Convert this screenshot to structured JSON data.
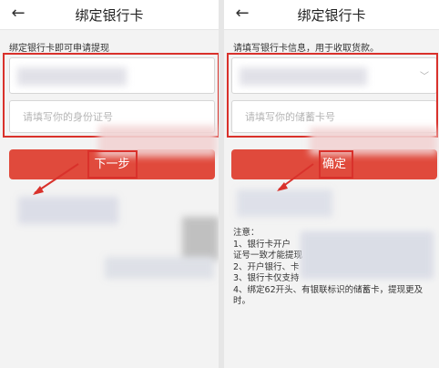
{
  "left_screen": {
    "title": "绑定银行卡",
    "hint": "绑定银行卡即可申请提现",
    "id_placeholder": "请填写你的身份证号",
    "next_button": "下一步"
  },
  "right_screen": {
    "title": "绑定银行卡",
    "hint": "请填写银行卡信息，用于收取货款。",
    "card_placeholder": "请填写你的储蓄卡号",
    "confirm_button": "确定",
    "notes_title": "注意：",
    "notes": [
      "1、银行卡开户",
      "证号一致才能提现",
      "2、开户银行、卡",
      "3、银行卡仅支持",
      "4、绑定62开头、有银联标识的储蓄卡，提现更及",
      "时。"
    ]
  },
  "colors": {
    "accent": "#e04a3c",
    "highlight": "#d9312b"
  },
  "icons": {
    "back": "back-arrow-icon",
    "dropdown": "chevron-down-icon"
  }
}
